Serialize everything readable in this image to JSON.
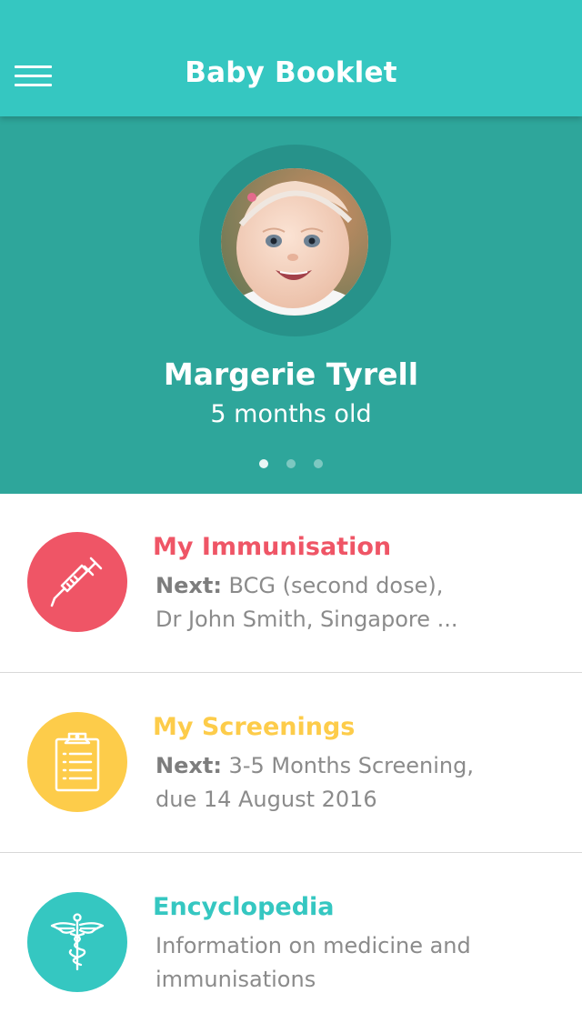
{
  "app": {
    "title": "Baby Booklet",
    "menu_icon": "hamburger-menu-icon",
    "colors": {
      "header": "#35c7c1",
      "hero": "#2ea69b"
    }
  },
  "profile": {
    "name": "Margerie Tyrell",
    "age": "5 months old",
    "pager": {
      "total": 3,
      "active": 1
    }
  },
  "cards": [
    {
      "title": "My Immunisation",
      "color": "#ef5566",
      "icon": "syringe-icon",
      "lead": "Next:",
      "line1_rest": " BCG (second dose),",
      "line2": "Dr John Smith, Singapore ..."
    },
    {
      "title": "My Screenings",
      "color": "#fdcc4a",
      "icon": "clipboard-icon",
      "lead": "Next:",
      "line1_rest": " 3-5 Months Screening,",
      "line2": "due 14 August 2016"
    },
    {
      "title": "Encyclopedia",
      "color": "#35c7c1",
      "icon": "caduceus-icon",
      "line1": "Information on medicine and",
      "line2": "immunisations"
    }
  ]
}
